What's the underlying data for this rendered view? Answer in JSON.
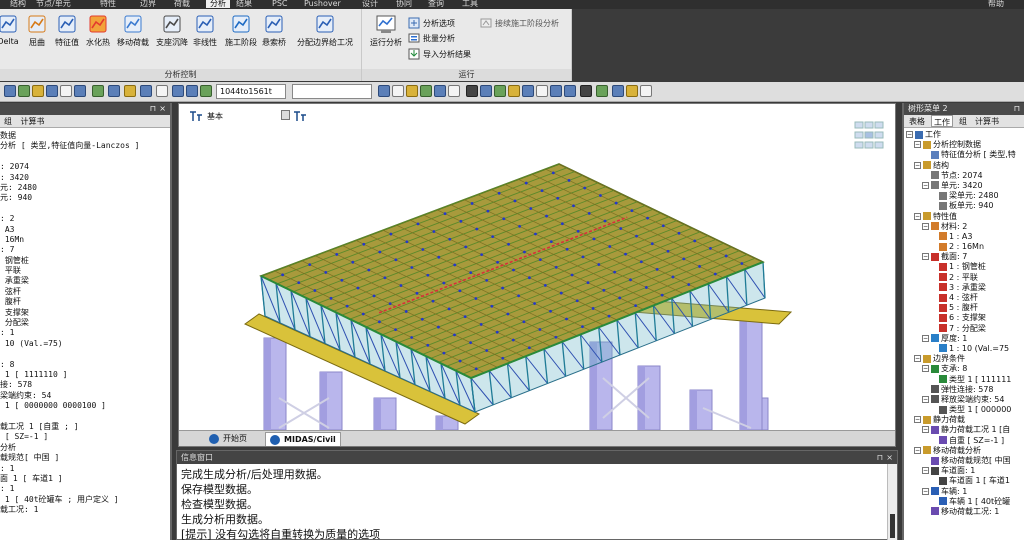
{
  "menu": {
    "items": [
      "结构",
      "节点/单元",
      "特性",
      "边界",
      "荷载",
      "分析",
      "结果",
      "PSC",
      "Pushover",
      "设计",
      "协同",
      "查询",
      "工具"
    ],
    "active": "分析",
    "help": "帮助"
  },
  "ribbon": {
    "analysis_control": {
      "label": "分析控制",
      "buttons": [
        "Delta",
        "屈曲",
        "特征值",
        "水化热",
        "移动荷载",
        "支座沉降",
        "非线性",
        "施工阶段",
        "悬索桥",
        "分配边界给工况"
      ]
    },
    "run": {
      "label": "运行",
      "run_button": "运行分析",
      "analysis_options": "分析选项",
      "batch_analysis": "批量分析",
      "import_results": "导入分析结果",
      "continue_cs": "接续施工阶段分析"
    }
  },
  "toolbar": {
    "selection_value": "1044to1561t",
    "icons": [
      "select-icon",
      "zoom-icon",
      "rotate-icon",
      "pan-icon",
      "hidden-icon",
      "shrink-icon",
      "node-number-icon",
      "element-number-icon"
    ]
  },
  "left_panel": {
    "tabs": [
      "组",
      "计算书"
    ],
    "lines": [
      "数据",
      "分析 [ 类型,特征值向量-Lanczos ]",
      "",
      ": 2074",
      ": 3420",
      "元: 2480",
      "元: 940",
      "",
      ": 2",
      " A3",
      " 16Mn",
      ": 7",
      " 钢管桩",
      " 平联",
      " 承重梁",
      " 弦杆",
      " 腹杆",
      " 支撑架",
      " 分配梁",
      ": 1",
      " 10 (Val.=75)",
      "",
      ": 8",
      " 1 [ 1111110 ]",
      "接: 578",
      "梁端约束: 54",
      " 1 [ 0000000 0000100 ]",
      "",
      "载工况 1 [自重 ; ]",
      " [ SZ=-1 ]",
      "分析",
      "载规范[ 中国 ]",
      ": 1",
      "面 1 [ 车道1 ]",
      ": 1",
      " 1 [ 40t砼罐车 ; 用户定义 ]",
      "载工况: 1"
    ]
  },
  "viewport": {
    "view_label": "基本",
    "tabs": [
      "开始页",
      "MIDAS/Civil"
    ],
    "active_tab": "MIDAS/Civil"
  },
  "info": {
    "title": "信息窗口",
    "lines": [
      "完成生成分析/后处理用数据。",
      "保存模型数据。",
      "检查模型数据。",
      "生成分析用数据。",
      "[提示] 没有勾选将自重转换为质量的选项"
    ]
  },
  "right_panel": {
    "title": "树形菜单 2",
    "tabs": [
      "表格",
      "工作",
      "组",
      "计算书"
    ],
    "active_tab": "工作",
    "tree": [
      {
        "d": 0,
        "t": "工作",
        "ic": "work"
      },
      {
        "d": 1,
        "t": "分析控制数据",
        "ic": "folder"
      },
      {
        "d": 2,
        "t": "特征值分析 [ 类型,特",
        "ic": "doc"
      },
      {
        "d": 1,
        "t": "结构",
        "ic": "folder"
      },
      {
        "d": 2,
        "t": "节点: 2074",
        "ic": "dot"
      },
      {
        "d": 2,
        "t": "单元: 3420",
        "ic": "dot"
      },
      {
        "d": 3,
        "t": "梁单元: 2480",
        "ic": "dot"
      },
      {
        "d": 3,
        "t": "板单元: 940",
        "ic": "dot"
      },
      {
        "d": 1,
        "t": "特性值",
        "ic": "folder"
      },
      {
        "d": 2,
        "t": "材料: 2",
        "ic": "mat"
      },
      {
        "d": 3,
        "t": "1 : A3",
        "ic": "mat"
      },
      {
        "d": 3,
        "t": "2 : 16Mn",
        "ic": "mat"
      },
      {
        "d": 2,
        "t": "截面: 7",
        "ic": "sec"
      },
      {
        "d": 3,
        "t": "1 : 钢管桩",
        "ic": "sec"
      },
      {
        "d": 3,
        "t": "2 : 平联",
        "ic": "sec"
      },
      {
        "d": 3,
        "t": "3 : 承重梁",
        "ic": "sec"
      },
      {
        "d": 3,
        "t": "4 : 弦杆",
        "ic": "sec"
      },
      {
        "d": 3,
        "t": "5 : 腹杆",
        "ic": "sec"
      },
      {
        "d": 3,
        "t": "6 : 支撑架",
        "ic": "sec"
      },
      {
        "d": 3,
        "t": "7 : 分配梁",
        "ic": "sec"
      },
      {
        "d": 2,
        "t": "厚度: 1",
        "ic": "thk"
      },
      {
        "d": 3,
        "t": "1 : 10 (Val.=75",
        "ic": "thk"
      },
      {
        "d": 1,
        "t": "边界条件",
        "ic": "folder"
      },
      {
        "d": 2,
        "t": "支承: 8",
        "ic": "sup"
      },
      {
        "d": 3,
        "t": "类型 1 [ 111111",
        "ic": "sup"
      },
      {
        "d": 2,
        "t": "弹性连接: 578",
        "ic": "lnk"
      },
      {
        "d": 2,
        "t": "释放梁端约束: 54",
        "ic": "lnk"
      },
      {
        "d": 3,
        "t": "类型 1 [ 000000",
        "ic": "lnk"
      },
      {
        "d": 1,
        "t": "静力荷载",
        "ic": "folder"
      },
      {
        "d": 2,
        "t": "静力荷载工况 1 [自",
        "ic": "load"
      },
      {
        "d": 3,
        "t": "自重 [ SZ=-1 ]",
        "ic": "load"
      },
      {
        "d": 1,
        "t": "移动荷载分析",
        "ic": "folder"
      },
      {
        "d": 2,
        "t": "移动荷载规范[ 中国",
        "ic": "load"
      },
      {
        "d": 2,
        "t": "车道面: 1",
        "ic": "lane"
      },
      {
        "d": 3,
        "t": "车道面 1 [ 车道1",
        "ic": "lane"
      },
      {
        "d": 2,
        "t": "车辆: 1",
        "ic": "car"
      },
      {
        "d": 3,
        "t": "车辆 1 [ 40t砼罐",
        "ic": "car"
      },
      {
        "d": 2,
        "t": "移动荷载工况: 1",
        "ic": "load"
      }
    ]
  }
}
